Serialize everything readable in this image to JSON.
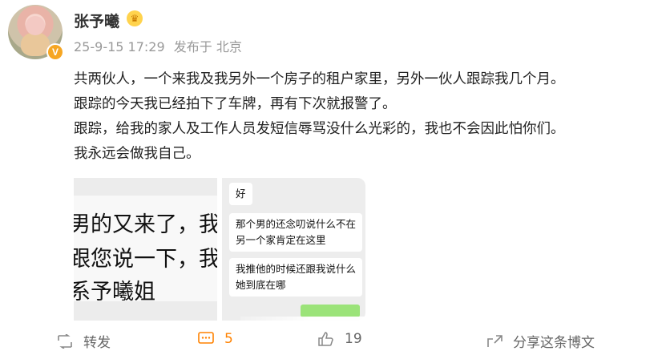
{
  "user": {
    "name": "张予曦",
    "timestamp": "25-9-15 17:29",
    "source": "发布于 北京"
  },
  "post": {
    "lines": [
      "共两伙人，一个来我及我另外一个房子的租户家里，另外一伙人跟踪我几个月。",
      "跟踪的今天我已经拍下了车牌，再有下次就报警了。",
      "跟踪，给我的家人及工作人员发短信辱骂没什么光彩的，我也不会因此怕你们。",
      "我永远会做我自己。"
    ]
  },
  "images": {
    "first": {
      "lines": [
        "男的又来了，我",
        "跟您说一下，我",
        "系予曦姐"
      ]
    },
    "second": {
      "bubbles": [
        "好",
        "那个男的还念叨说什么不在\n另一个家肯定在这里",
        "我推他的时候还跟我说什么\n她到底在哪"
      ]
    }
  },
  "actions": {
    "repost_label": "转发",
    "comment_count": "5",
    "like_count": "19",
    "share_label": "分享这条博文"
  },
  "colors": {
    "accent": "#ff8200",
    "verified": "#f6a623"
  }
}
